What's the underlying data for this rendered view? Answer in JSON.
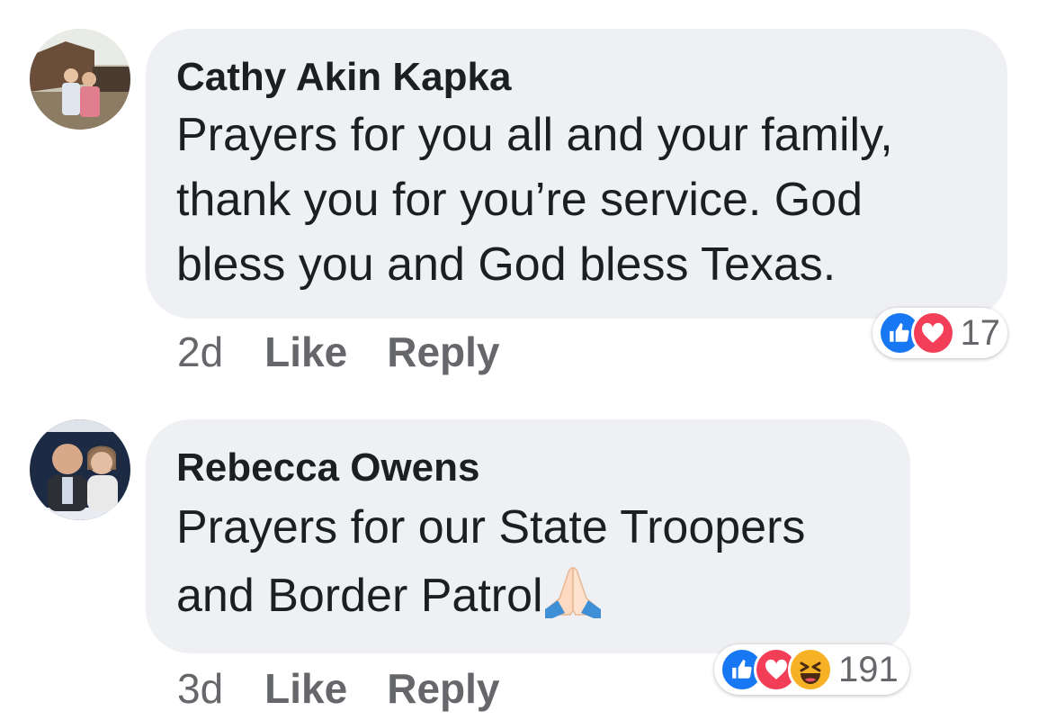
{
  "comments": [
    {
      "author": "Cathy Akin Kapka",
      "lines": [
        "Prayers for you all and your family,",
        "thank you for you’re service. God",
        "bless you and God bless Texas."
      ],
      "time": "2d",
      "like_label": "Like",
      "reply_label": "Reply",
      "reaction_count": "17",
      "reactions": [
        "like-icon",
        "love-icon"
      ]
    },
    {
      "author": "Rebecca Owens",
      "lines": [
        "Prayers for our State Troopers",
        "and Border Patrol"
      ],
      "emoji": "folded-hands-emoji",
      "time": "3d",
      "like_label": "Like",
      "reply_label": "Reply",
      "reaction_count": "191",
      "reactions": [
        "like-icon",
        "love-icon",
        "haha-icon"
      ]
    }
  ],
  "colors": {
    "bubble": "#eff0f3",
    "meta_text": "#65676b",
    "like_blue": "#1877f2",
    "love_red": "#f33e58",
    "haha_yellow": "#f7b125"
  }
}
